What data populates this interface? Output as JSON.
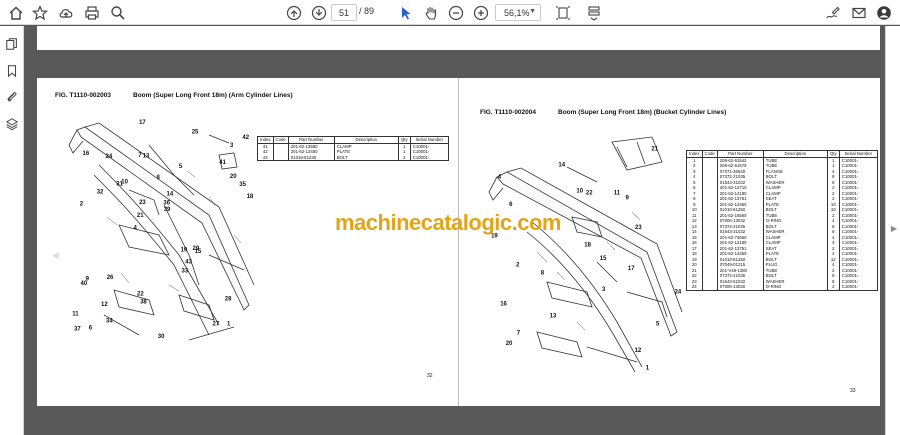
{
  "toolbar": {
    "current_page": "51",
    "page_total": "/ 89",
    "zoom": "56,1%"
  },
  "pages": [
    {
      "figure_no": "FIG. T1110-002003",
      "title": "Boom (Super Long Front 18m) (Arm Cylinder Lines)",
      "page_number": "32",
      "headers": [
        "Index",
        "Code",
        "Part Number",
        "Description",
        "Qty",
        "Serial Number"
      ],
      "rows": [
        [
          "41",
          "",
          "201-62-13580",
          "CLAMP",
          "1",
          "C10001-"
        ],
        [
          "42",
          "",
          "201-62-13450",
          "PLATE",
          "1",
          "C10001-"
        ],
        [
          "43",
          "",
          "01010-81230",
          "BOLT",
          "2",
          "C10001-"
        ]
      ],
      "callouts": [
        "1",
        "2",
        "3",
        "4",
        "5",
        "6",
        "7",
        "8",
        "9",
        "10",
        "11",
        "12",
        "13",
        "14",
        "15",
        "16",
        "17",
        "18",
        "19",
        "20",
        "21",
        "22",
        "23",
        "24",
        "25",
        "26",
        "27",
        "28",
        "29",
        "30",
        "31",
        "32",
        "33",
        "34",
        "35",
        "36",
        "37",
        "38",
        "39",
        "40",
        "41",
        "42",
        "43"
      ]
    },
    {
      "figure_no": "FIG. T1110-002004",
      "title": "Boom (Super Long Front 18m) (Bucket Cylinder Lines)",
      "page_number": "33",
      "headers": [
        "Index",
        "Code",
        "Part Number",
        "Description",
        "Qty",
        "Serial Number"
      ],
      "rows": [
        [
          "1",
          "",
          "208-62-61542",
          "TUBE",
          "1",
          "C10001-"
        ],
        [
          "2",
          "",
          "208-62-61570",
          "TUBE",
          "1",
          "C10001-"
        ],
        [
          "3",
          "",
          "07371-30640",
          "FLANGE",
          "4",
          "C10001-"
        ],
        [
          "4",
          "",
          "07372-21035",
          "BOLT",
          "8",
          "C10001-"
        ],
        [
          "5",
          "",
          "01643-31032",
          "WASHER",
          "8",
          "C10001-"
        ],
        [
          "6",
          "",
          "201-62-12710",
          "CLAMP",
          "2",
          "C10001-"
        ],
        [
          "7",
          "",
          "201-62-12180",
          "CLAMP",
          "2",
          "C10001-"
        ],
        [
          "8",
          "",
          "201-62-13761",
          "SEAT",
          "2",
          "C10001-"
        ],
        [
          "9",
          "",
          "201-62-13450",
          "PLATE",
          "10",
          "C10001-"
        ],
        [
          "10",
          "",
          "01010-81250",
          "BOLT",
          "10",
          "C10001-"
        ],
        [
          "11",
          "",
          "201-62-16560",
          "TUBE",
          "2",
          "C10001-"
        ],
        [
          "12",
          "",
          "07000-13032",
          "O-RING",
          "4",
          "C10001-"
        ],
        [
          "13",
          "",
          "07372-21035",
          "BOLT",
          "8",
          "C10001-"
        ],
        [
          "14",
          "",
          "01643-31032",
          "WASHER",
          "8",
          "C10001-"
        ],
        [
          "15",
          "",
          "201-62-73660",
          "CLAMP",
          "4",
          "C10001-"
        ],
        [
          "16",
          "",
          "201-62-12180",
          "CLAMP",
          "4",
          "C10001-"
        ],
        [
          "17",
          "",
          "201-62-13761",
          "SEAT",
          "2",
          "C10001-"
        ],
        [
          "18",
          "",
          "201-62-13450",
          "PLATE",
          "4",
          "C10001-"
        ],
        [
          "19",
          "",
          "01010-81250",
          "BOLT",
          "12",
          "C10001-"
        ],
        [
          "20",
          "",
          "07049-01215",
          "PLUG",
          "4",
          "C10001-"
        ],
        [
          "21",
          "",
          "201-V48-1380",
          "TUBE",
          "2",
          "C10001-"
        ],
        [
          "22",
          "",
          "07372-21035",
          "BOLT",
          "8",
          "C10001-"
        ],
        [
          "23",
          "",
          "01643-51032",
          "WASHER",
          "8",
          "C10001-"
        ],
        [
          "24",
          "",
          "07000-13030",
          "O-RING",
          "2",
          "C10001-"
        ]
      ],
      "callouts": [
        "1",
        "2",
        "3",
        "4",
        "5",
        "6",
        "7",
        "8",
        "9",
        "10",
        "11",
        "12",
        "13",
        "14",
        "15",
        "16",
        "17",
        "18",
        "19",
        "20",
        "21",
        "22",
        "23",
        "24"
      ]
    }
  ],
  "watermark": "machinecatalogic.com",
  "icons": {
    "toolbar_left": [
      "home-icon",
      "star-icon",
      "upload-icon",
      "print-icon",
      "search-icon"
    ],
    "toolbar_center": [
      "page-up-icon",
      "page-down-icon",
      "select-cursor-icon",
      "hand-icon",
      "zoom-out-icon",
      "zoom-in-icon",
      "fit-page-icon",
      "scroll-mode-icon"
    ],
    "toolbar_right": [
      "sign-icon",
      "mail-icon",
      "account-icon"
    ],
    "left_rail": [
      "pages-icon",
      "bookmark-icon",
      "attachment-icon",
      "layers-icon"
    ]
  },
  "colors": {
    "watermark": "#e1a51a",
    "background": "#595959",
    "toolbar": "#ffffff"
  }
}
